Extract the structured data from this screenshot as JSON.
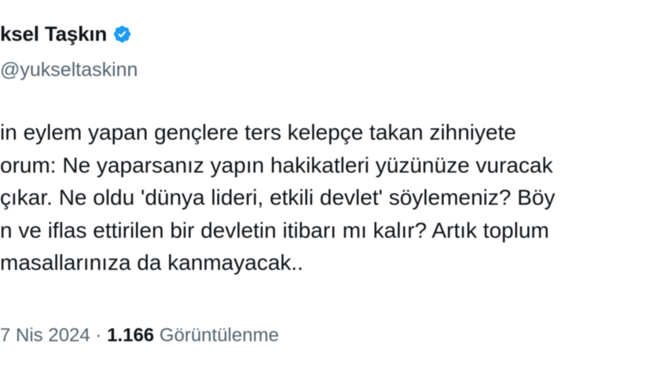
{
  "author": {
    "display_name": "ksel Taşkın",
    "handle": "yukseltaskinn",
    "verified": true,
    "verified_color": "#1d9bf0"
  },
  "tweet": {
    "lines": [
      "in eylem yapan gençlere ters kelepçe takan zihniyete",
      "orum: Ne yaparsanız yapın hakikatleri yüzünüze vuracak",
      "çıkar. Ne oldu 'dünya lideri, etkili devlet' söylemeniz? Böy",
      "n ve iflas ettirilen bir devletin itibarı mı kalır? Artık toplum",
      "masallarınıza da kanmayacak.."
    ]
  },
  "meta": {
    "date": "7 Nis 2024",
    "separator": "·",
    "views_count": "1.166",
    "views_label": "Görüntülenme"
  }
}
